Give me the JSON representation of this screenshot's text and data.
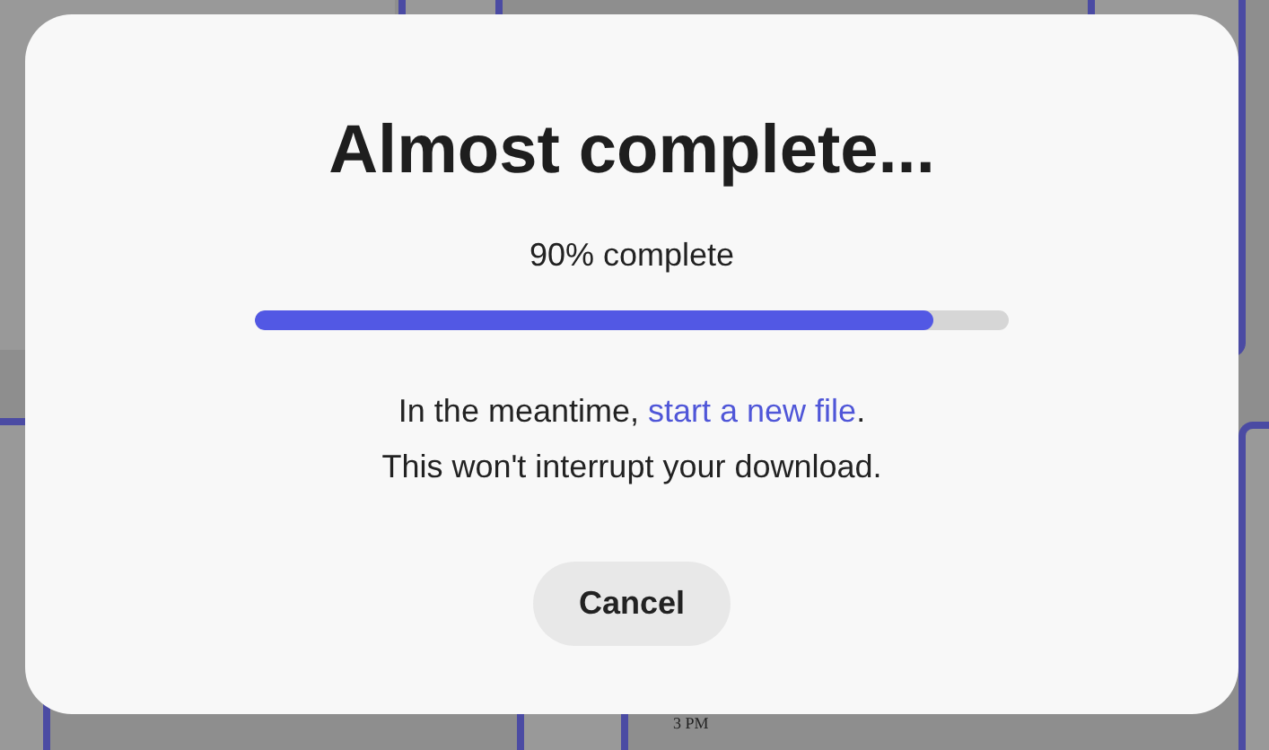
{
  "background": {
    "time_label": "3 PM"
  },
  "dialog": {
    "title": "Almost complete...",
    "progress": {
      "label": "90% complete",
      "level": 0.9
    },
    "message": {
      "prefix": "In the meantime, ",
      "link": "start a new file",
      "suffix": "."
    },
    "note": "This won't interrupt your download.",
    "buttons": [
      {
        "label": "Cancel"
      }
    ]
  }
}
